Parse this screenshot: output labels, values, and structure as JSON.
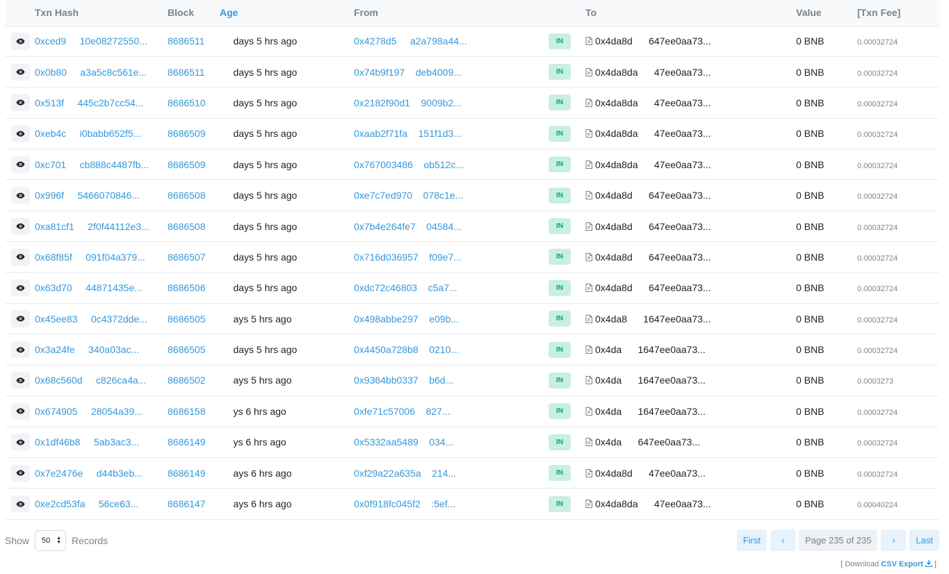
{
  "table": {
    "headers": {
      "txn_hash": "Txn Hash",
      "block": "Block",
      "age": "Age",
      "from": "From",
      "to": "To",
      "value": "Value",
      "fee": "[Txn Fee]"
    },
    "rows": [
      {
        "hash": "0xced9     10e08272550...",
        "block": "8686511",
        "age": "     days 5 hrs ago",
        "from": "0x4278d5     a2a798a44...",
        "dir": "IN",
        "to": "0x4da8d      647ee0aa73...",
        "value": "0 BNB",
        "fee": "0.00032724"
      },
      {
        "hash": "0x0b80     a3a5c8c561e...",
        "block": "8686511",
        "age": "     days 5 hrs ago",
        "from": "0x74b9f197    deb4009...",
        "dir": "IN",
        "to": "0x4da8da      47ee0aa73...",
        "value": "0 BNB",
        "fee": "0.00032724"
      },
      {
        "hash": "0x513f     445c2b7cc54...",
        "block": "8686510",
        "age": "     days 5 hrs ago",
        "from": "0x2182f90d1    9009b2...",
        "dir": "IN",
        "to": "0x4da8da      47ee0aa73...",
        "value": "0 BNB",
        "fee": "0.00032724"
      },
      {
        "hash": "0xeb4c     i0babb652f5...",
        "block": "8686509",
        "age": "     days 5 hrs ago",
        "from": "0xaab2f71fa    151f1d3...",
        "dir": "IN",
        "to": "0x4da8da      47ee0aa73...",
        "value": "0 BNB",
        "fee": "0.00032724"
      },
      {
        "hash": "0xc701     cb888c4487fb...",
        "block": "8686509",
        "age": "     days 5 hrs ago",
        "from": "0x767003486    ob512c...",
        "dir": "IN",
        "to": "0x4da8da      47ee0aa73...",
        "value": "0 BNB",
        "fee": "0.00032724"
      },
      {
        "hash": "0x996f     5466070846...",
        "block": "8686508",
        "age": "     days 5 hrs ago",
        "from": "0xe7c7ed970    078c1e...",
        "dir": "IN",
        "to": "0x4da8d      647ee0aa73...",
        "value": "0 BNB",
        "fee": "0.00032724"
      },
      {
        "hash": "0xa81cf1     2f0f44112e3...",
        "block": "8686508",
        "age": "     days 5 hrs ago",
        "from": "0x7b4e264fe7    04584...",
        "dir": "IN",
        "to": "0x4da8d      647ee0aa73...",
        "value": "0 BNB",
        "fee": "0.00032724"
      },
      {
        "hash": "0x68f85f     091f04a379...",
        "block": "8686507",
        "age": "     days 5 hrs ago",
        "from": "0x716d036957    f09e7...",
        "dir": "IN",
        "to": "0x4da8d      647ee0aa73...",
        "value": "0 BNB",
        "fee": "0.00032724"
      },
      {
        "hash": "0x63d70     44871435e...",
        "block": "8686506",
        "age": "     days 5 hrs ago",
        "from": "0xdc72c46803    c5a7...",
        "dir": "IN",
        "to": "0x4da8d      647ee0aa73...",
        "value": "0 BNB",
        "fee": "0.00032724"
      },
      {
        "hash": "0x45ee83     0c4372dde...",
        "block": "8686505",
        "age": "     ays 5 hrs ago",
        "from": "0x498abbe297    e09b...",
        "dir": "IN",
        "to": "0x4da8      1647ee0aa73...",
        "value": "0 BNB",
        "fee": "0.00032724"
      },
      {
        "hash": "0x3a24fe     340a03ac...",
        "block": "8686505",
        "age": "     days 5 hrs ago",
        "from": "0x4450a728b8    0210...",
        "dir": "IN",
        "to": "0x4da      1647ee0aa73...",
        "value": "0 BNB",
        "fee": "0.00032724"
      },
      {
        "hash": "0x68c560d     c826ca4a...",
        "block": "8686502",
        "age": "     ays 5 hrs ago",
        "from": "0x9364bb0337    b6d...",
        "dir": "IN",
        "to": "0x4da      1647ee0aa73...",
        "value": "0 BNB",
        "fee": "0.0003273"
      },
      {
        "hash": "0x674905     28054a39...",
        "block": "8686158",
        "age": "     ys 6 hrs ago",
        "from": "0xfe71c57006    827...",
        "dir": "IN",
        "to": "0x4da      1647ee0aa73...",
        "value": "0 BNB",
        "fee": "0.00032724"
      },
      {
        "hash": "0x1df46b8     5ab3ac3...",
        "block": "8686149",
        "age": "     ys 6 hrs ago",
        "from": "0x5332aa5489    034...",
        "dir": "IN",
        "to": "0x4da      647ee0aa73...",
        "value": "0 BNB",
        "fee": "0.00032724"
      },
      {
        "hash": "0x7e2476e     d44b3eb...",
        "block": "8686149",
        "age": "     ays 6 hrs ago",
        "from": "0xf29a22a635a    214...",
        "dir": "IN",
        "to": "0x4da8d      47ee0aa73...",
        "value": "0 BNB",
        "fee": "0.00032724"
      },
      {
        "hash": "0xe2cd53fa     56ce63...",
        "block": "8686147",
        "age": "     ays 6 hrs ago",
        "from": "0x0f918fc045f2    :5ef...",
        "dir": "IN",
        "to": "0x4da8da      47ee0aa73...",
        "value": "0 BNB",
        "fee": "0.00040224"
      }
    ]
  },
  "footer": {
    "show_label": "Show",
    "records_value": "50",
    "records_label": "Records"
  },
  "pagination": {
    "first": "First",
    "prev": "‹",
    "page_info": "Page 235 of 235",
    "next": "›",
    "last": "Last"
  },
  "csv": {
    "open": "[ Download ",
    "link": "CSV Export",
    "close": " ]"
  },
  "icons": {
    "view": "eye-icon",
    "contract": "document-icon",
    "download": "download-icon",
    "select_arrow": "chevron-updown-icon"
  },
  "colors": {
    "link": "#3498db",
    "in_badge_bg": "#c9efe5",
    "in_badge_text": "#00a186",
    "header_text": "#77838f"
  }
}
